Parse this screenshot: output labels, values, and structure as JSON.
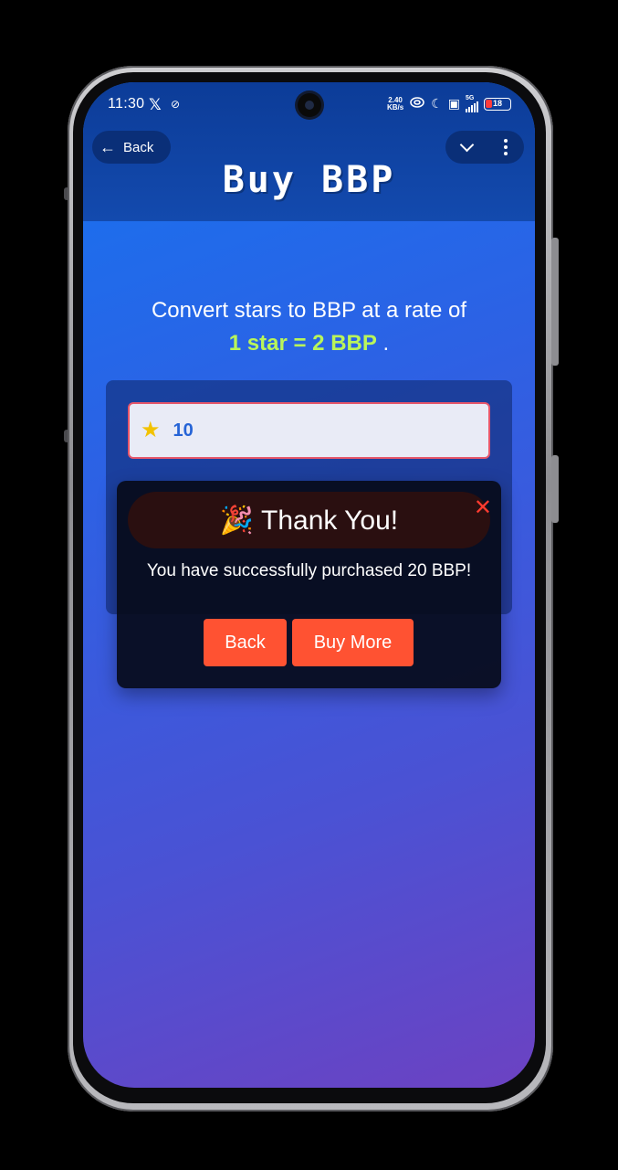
{
  "status_bar": {
    "time": "11:30",
    "x_glyph": "𝕏",
    "link_glyph": "⊘",
    "net_speed_value": "2.40",
    "net_speed_unit": "KB/s",
    "moon_glyph": "☾",
    "lte_glyph": "▣",
    "network": "5G",
    "battery": "18"
  },
  "header": {
    "back_label": "Back",
    "back_arrow": "←",
    "title": "Buy BBP"
  },
  "intro": {
    "line1": "Convert stars to BBP at a rate of",
    "rate": "1 star = 2 BBP",
    "suffix": " ."
  },
  "form": {
    "star_glyph": "★",
    "stars_value": "10"
  },
  "modal": {
    "title": "🎉 Thank You!",
    "close_glyph": "✕",
    "message": "You have successfully purchased 20 BBP!",
    "back_label": "Back",
    "buy_more_label": "Buy More"
  },
  "colors": {
    "accent_green": "#b9f55a",
    "button_orange": "#ff5232",
    "close_red": "#ff3b30"
  }
}
